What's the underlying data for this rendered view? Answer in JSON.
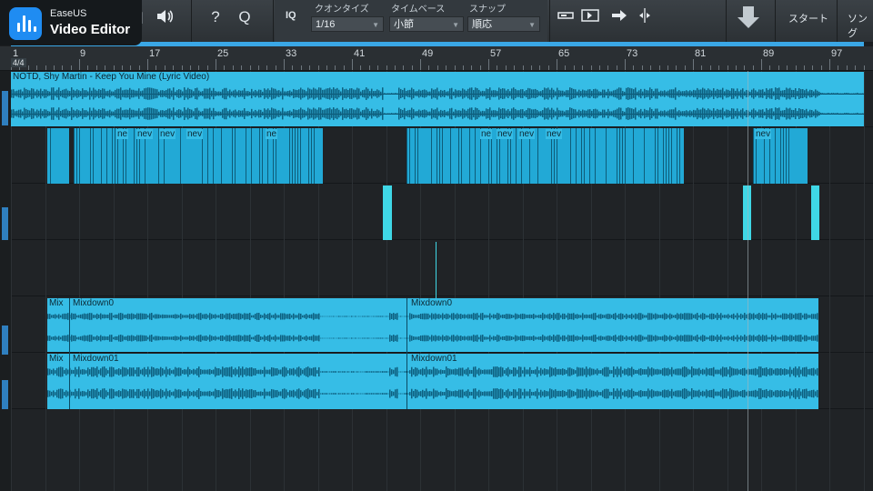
{
  "badge": {
    "brand": "EaseUS",
    "product": "Video Editor"
  },
  "toolbar": {
    "help_glyph": "?",
    "q_glyph": "Q",
    "iq_label": "IQ",
    "quantize": {
      "label": "クオンタイズ",
      "value": "1/16"
    },
    "timebase": {
      "label": "タイムベース",
      "value": "小節"
    },
    "snap": {
      "label": "スナップ",
      "value": "順応"
    },
    "start_label": "スタート",
    "song_label": "ソング"
  },
  "ruler": {
    "time_signature": "4/4",
    "bars": [
      "1",
      "9",
      "17",
      "25",
      "33",
      "41",
      "49",
      "57",
      "65",
      "73",
      "81",
      "89",
      "97"
    ]
  },
  "tracks": {
    "track1_title": "NOTD, Shy Martin - Keep You Mine (Lyric Video)",
    "clip_short_label": "ne",
    "clip_short_label_alt": "nev",
    "mixdown_a": "Mixdown0",
    "mixdown_a_cut": "Mix",
    "mixdown_b": "Mixdown01",
    "mixdown_b_cut": "Mix"
  },
  "colors": {
    "accent": "#36bde6",
    "range": "#3aa7e6",
    "background": "#202326"
  }
}
